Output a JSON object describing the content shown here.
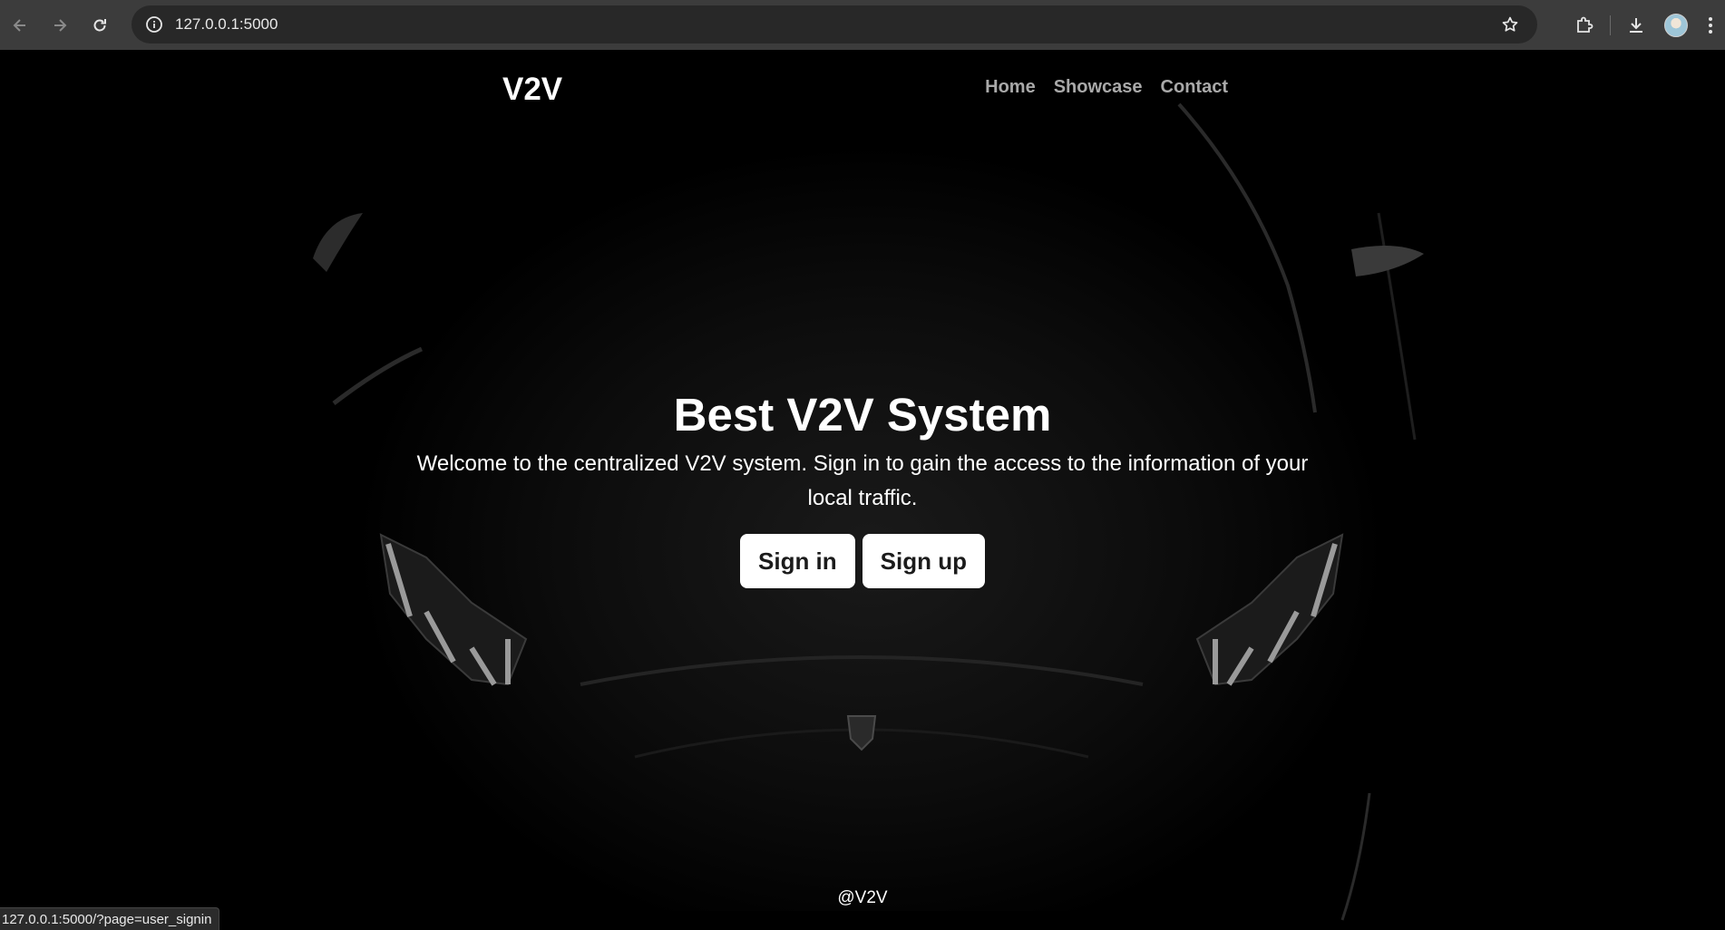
{
  "browser": {
    "url": "127.0.0.1:5000",
    "status_url": "127.0.0.1:5000/?page=user_signin"
  },
  "site": {
    "brand": "V2V",
    "nav": [
      {
        "label": "Home"
      },
      {
        "label": "Showcase"
      },
      {
        "label": "Contact"
      }
    ],
    "hero": {
      "title": "Best V2V System",
      "subtitle": "Welcome to the centralized V2V system. Sign in to gain the access to the information of your local traffic.",
      "signin_label": "Sign in",
      "signup_label": "Sign up"
    },
    "footer": "@V2V"
  },
  "icons": {
    "back": "arrow-left-icon",
    "forward": "arrow-right-icon",
    "reload": "reload-icon",
    "site_info": "info-icon",
    "bookmark": "star-icon",
    "extensions": "puzzle-icon",
    "downloads": "download-icon",
    "menu": "kebab-menu-icon"
  },
  "colors": {
    "page_bg": "#000000",
    "nav_link": "#a9a9a9",
    "button_bg": "#ffffff",
    "chrome_bar": "#3c3c3c"
  }
}
